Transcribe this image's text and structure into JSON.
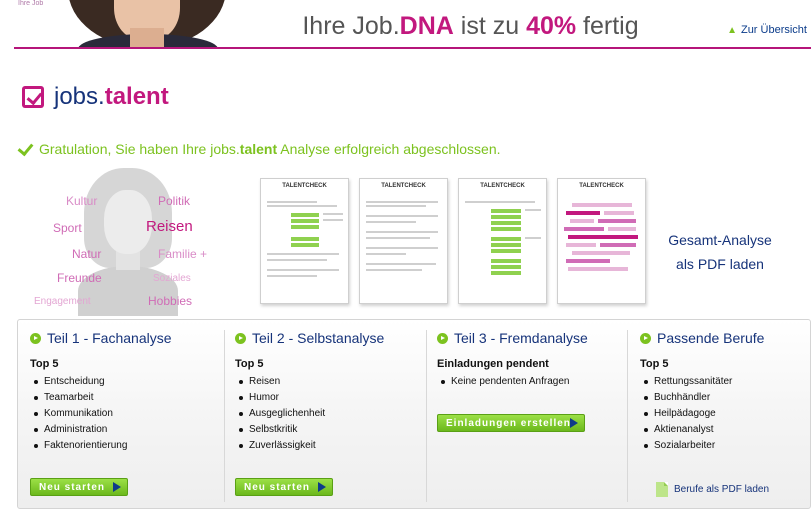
{
  "header": {
    "tiny_label": "Ihre Job",
    "title_prefix": "Ihre Job.",
    "title_brand": "DNA",
    "title_mid": " ist zu ",
    "title_percent": "40%",
    "title_suffix": " fertig",
    "progress_percent": 40,
    "overview_link": "Zur Übersicht"
  },
  "logo": {
    "name_part1": "jobs.",
    "name_part2": "talent"
  },
  "success": {
    "text_before": "Gratulation, Sie haben Ihre jobs.",
    "text_bold": "talent",
    "text_after": " Analyse erfolgreich abgeschlossen."
  },
  "interests": {
    "kultur": "Kultur",
    "politik": "Politik",
    "sport": "Sport",
    "reisen": "Reisen",
    "natur": "Natur",
    "familie": "Familie +",
    "freunde": "Freunde",
    "soziales": "Soziales",
    "engagement": "Engagement",
    "hobbies": "Hobbies"
  },
  "reports": {
    "thumb_title": "TALENTCHECK",
    "pdf_line1": "Gesamt-Analyse",
    "pdf_line2": "als PDF laden"
  },
  "sections": [
    {
      "title": "Teil 1 - Fachanalyse",
      "subtitle": "Top 5",
      "items": [
        "Entscheidung",
        "Teamarbeit",
        "Kommunikation",
        "Administration",
        "Faktenorientierung"
      ],
      "button": "Neu starten"
    },
    {
      "title": "Teil 2 - Selbstanalyse",
      "subtitle": "Top 5",
      "items": [
        "Reisen",
        "Humor",
        "Ausgeglichenheit",
        "Selbstkritik",
        "Zuverlässigkeit"
      ],
      "button": "Neu starten"
    },
    {
      "title": "Teil 3 - Fremdanalyse",
      "subtitle": "Einladungen pendent",
      "items": [
        "Keine pendenten Anfragen"
      ],
      "button": "Einladungen erstellen"
    },
    {
      "title": "Passende Berufe",
      "subtitle": "Top 5",
      "items": [
        "Rettungssanitäter",
        "Buchhändler",
        "Heilpädagoge",
        "Aktienanalyst",
        "Sozialarbeiter"
      ],
      "link": "Berufe als PDF laden"
    }
  ],
  "colors": {
    "brand_magenta": "#c2187e",
    "brand_navy": "#16337a",
    "accent_green": "#7cc21f",
    "interest_pink": "#d06cb6"
  },
  "icons": [
    "arrow-up-icon",
    "checkbox-logo-icon",
    "checkmark-icon",
    "play-circle-icon",
    "pdf-file-icon",
    "play-arrow-icon"
  ]
}
